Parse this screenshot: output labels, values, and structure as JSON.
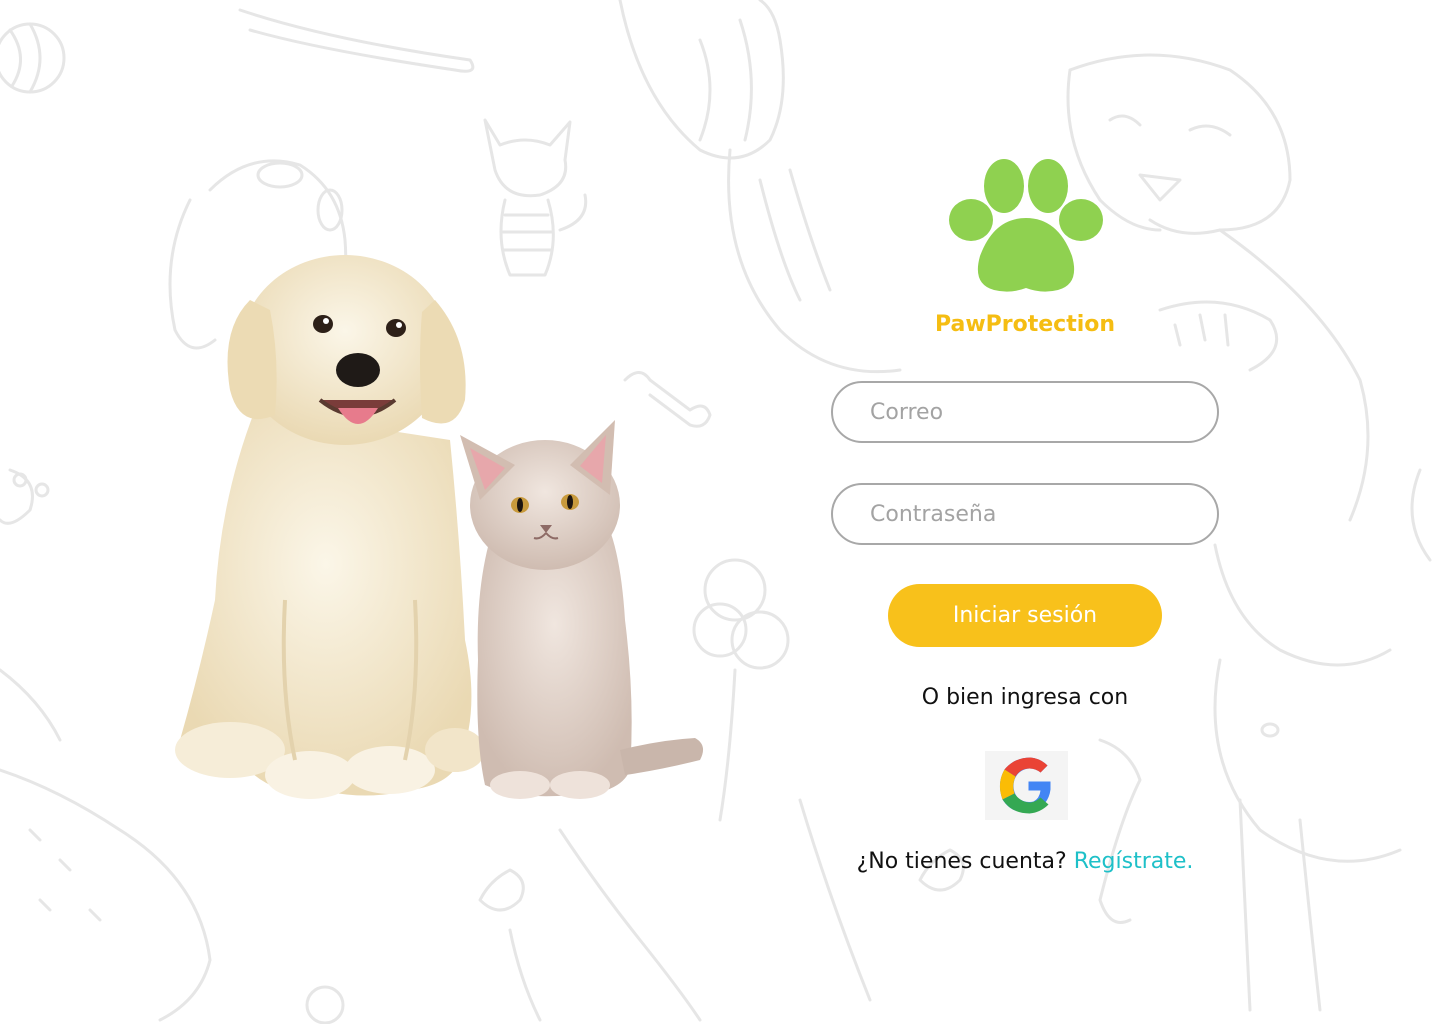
{
  "brand": {
    "name": "PawProtection",
    "logo_icon": "paw-print-icon",
    "color": "#f5bd12",
    "logo_color": "#8fd150"
  },
  "hero": {
    "image": "puppy-and-kitten-photo"
  },
  "login_form": {
    "email_placeholder": "Correo",
    "password_placeholder": "Contraseña",
    "submit_label": "Iniciar sesión",
    "submit_color": "#f8c11b"
  },
  "social_login": {
    "prompt": "O bien ingresa con",
    "google_icon": "google-g-icon"
  },
  "register": {
    "prompt": "¿No tienes cuenta?",
    "link_label": "Regístrate.",
    "link_color": "#1ec0c8"
  }
}
